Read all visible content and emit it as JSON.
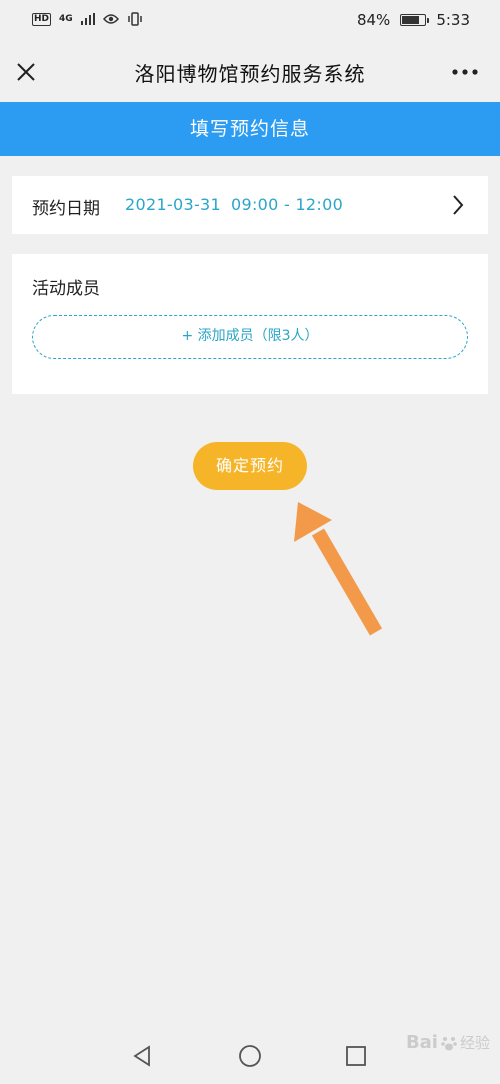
{
  "status_bar": {
    "hd": "HD",
    "network": "4G",
    "battery_percent": "84%",
    "battery_level": 0.84,
    "time": "5:33"
  },
  "navbar": {
    "title": "洛阳博物馆预约服务系统",
    "close_icon": "close-icon",
    "more_icon": "more-icon"
  },
  "banner": {
    "text": "填写预约信息"
  },
  "reservation": {
    "date_label": "预约日期",
    "date_value": "2021-03-31",
    "time_value": "09:00 - 12:00"
  },
  "members": {
    "label": "活动成员",
    "add_button": "+ 添加成员（限3人）"
  },
  "confirm": {
    "label": "确定预约"
  },
  "colors": {
    "banner_blue": "#2b9cf2",
    "accent_teal": "#2aa6c8",
    "confirm_orange": "#f6b528",
    "arrow_orange": "#f39a4a"
  },
  "watermark": {
    "brand": "Bai",
    "sub": "经验"
  }
}
